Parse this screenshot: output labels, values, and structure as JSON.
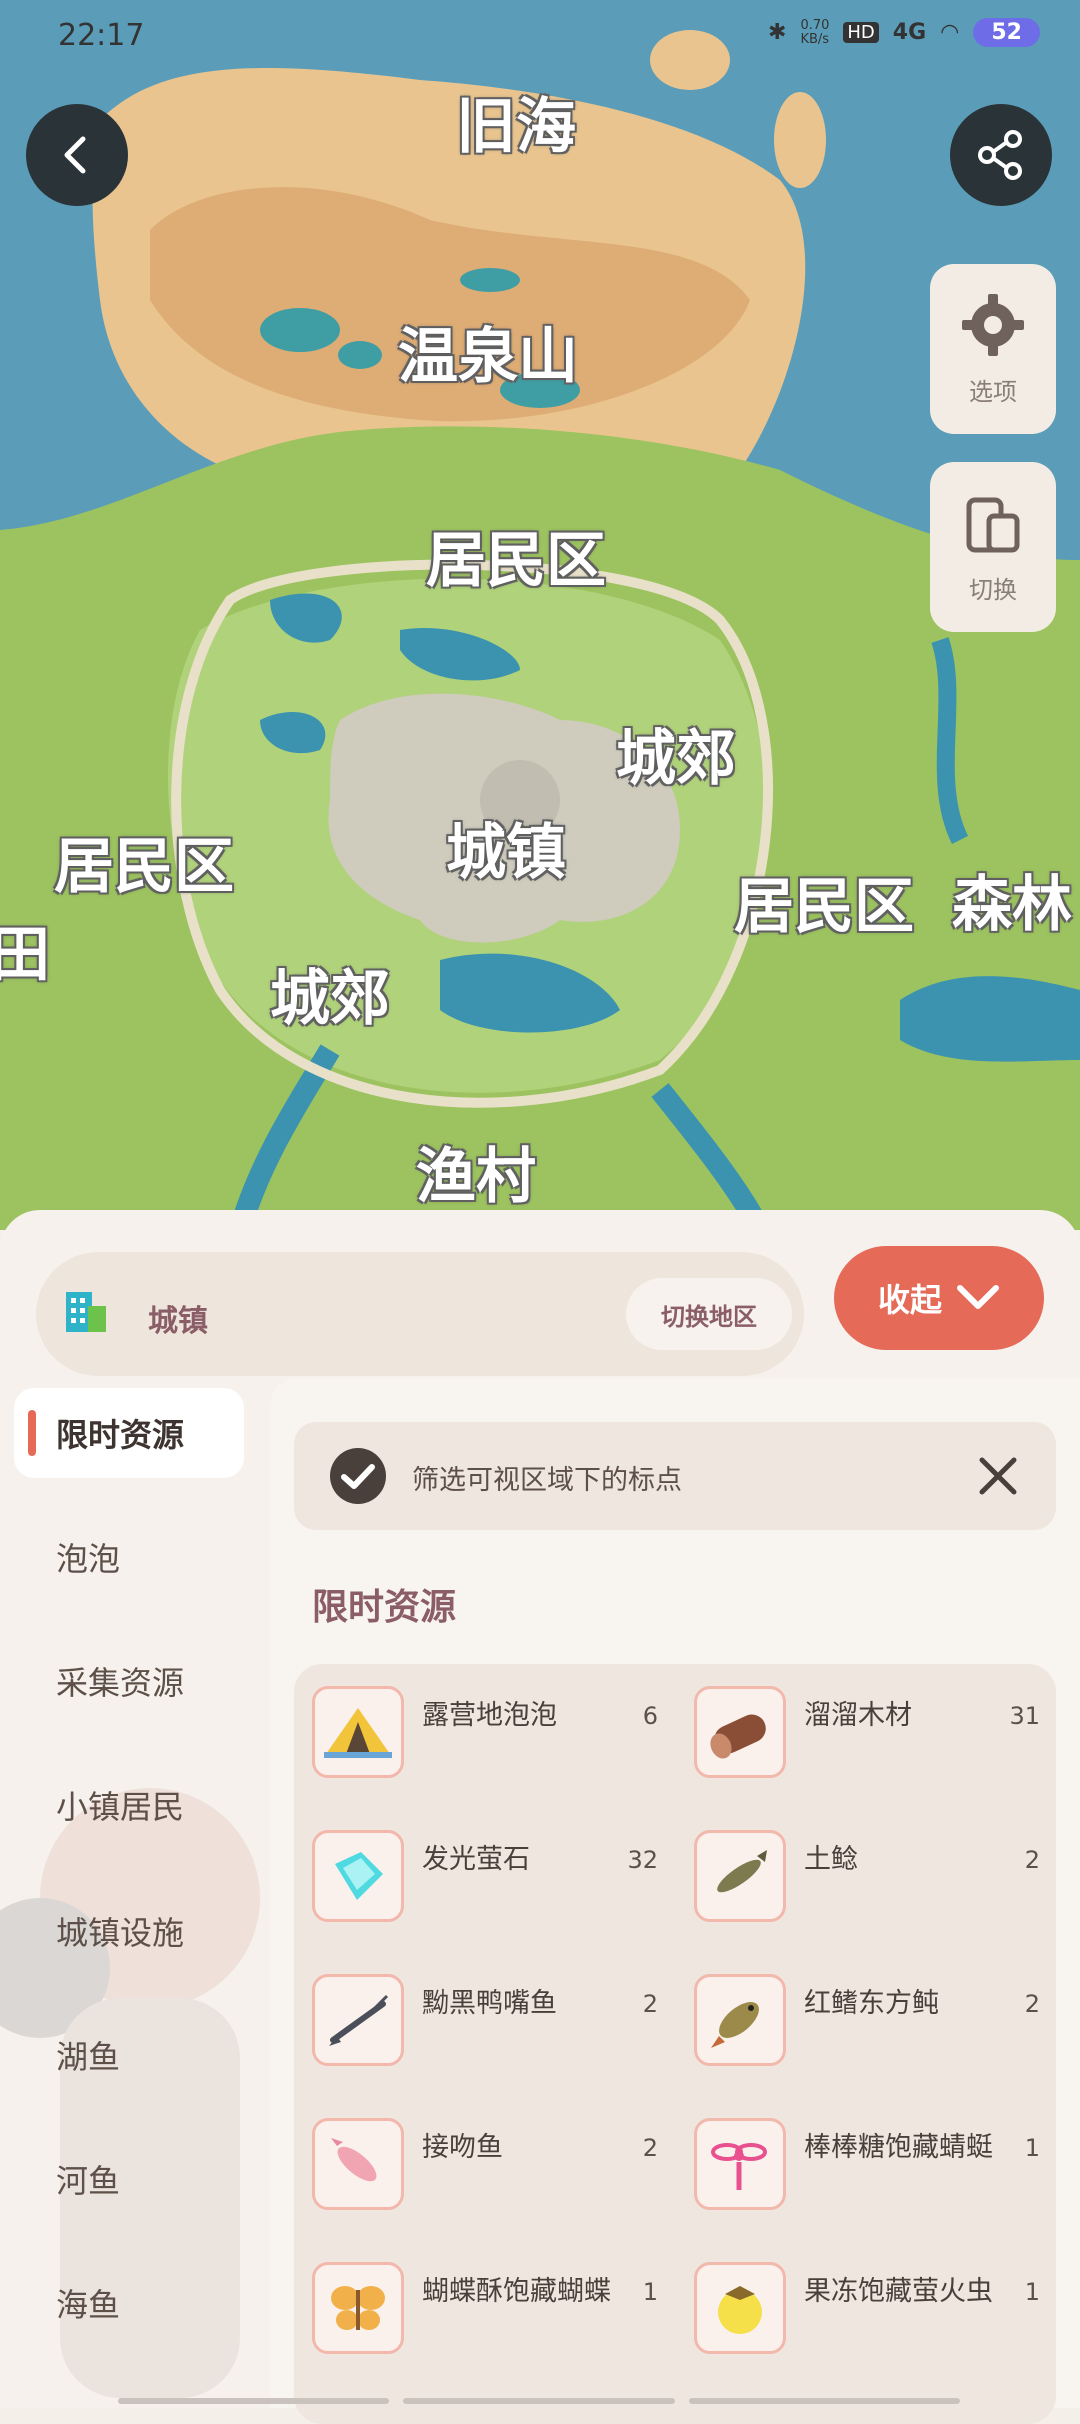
{
  "status_bar": {
    "time": "22:17",
    "net_speed": "0.70\nKB/s",
    "hd": "HD",
    "network": "4G",
    "battery": "52"
  },
  "map": {
    "labels": {
      "old_sea": "旧海",
      "hot_spring": "温泉山",
      "residential_north": "居民区",
      "suburb_east": "城郊",
      "residential_west": "居民区",
      "town": "城镇",
      "residential_east": "居民区",
      "forest": "森林",
      "field_partial": "田",
      "suburb_west": "城郊",
      "fishing_village": "渔村"
    },
    "options_label": "选项",
    "switch_label": "切换"
  },
  "sheet": {
    "region_name": "城镇",
    "switch_region_label": "切换地区",
    "collapse_label": "收起",
    "categories": [
      {
        "label": "限时资源",
        "active": true
      },
      {
        "label": "泡泡"
      },
      {
        "label": "采集资源"
      },
      {
        "label": "小镇居民"
      },
      {
        "label": "城镇设施"
      },
      {
        "label": "湖鱼"
      },
      {
        "label": "河鱼"
      },
      {
        "label": "海鱼"
      }
    ],
    "filter_text": "筛选可视区域下的标点",
    "section_title": "限时资源",
    "items": [
      {
        "name": "露营地泡泡",
        "count": "6",
        "icon": "tent-icon"
      },
      {
        "name": "溜溜木材",
        "count": "31",
        "icon": "wood-log-icon"
      },
      {
        "name": "发光萤石",
        "count": "32",
        "icon": "gem-icon"
      },
      {
        "name": "土鲶",
        "count": "2",
        "icon": "catfish-icon"
      },
      {
        "name": "黝黑鸭嘴鱼",
        "count": "2",
        "icon": "paddlefish-icon"
      },
      {
        "name": "红鳍东方鲀",
        "count": "2",
        "icon": "pufferfish-icon"
      },
      {
        "name": "接吻鱼",
        "count": "2",
        "icon": "kissing-fish-icon"
      },
      {
        "name": "棒棒糖饱藏蜻蜓",
        "count": "1",
        "icon": "dragonfly-icon"
      },
      {
        "name": "蝴蝶酥饱藏蝴蝶",
        "count": "1",
        "icon": "butterfly-icon"
      },
      {
        "name": "果冻饱藏萤火虫",
        "count": "1",
        "icon": "firefly-icon"
      }
    ]
  }
}
